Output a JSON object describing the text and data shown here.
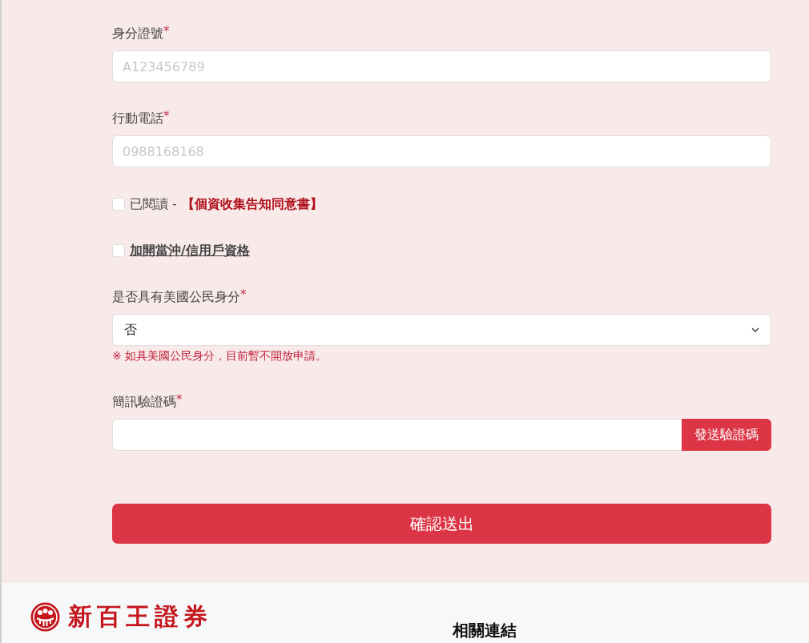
{
  "form": {
    "fields": [
      {
        "kind": "text",
        "label": "身分證號",
        "required_mark": "*",
        "placeholder": "A123456789"
      },
      {
        "kind": "text",
        "label": "行動電話",
        "required_mark": "*",
        "placeholder": "0988168168"
      },
      {
        "kind": "consent-checkbox",
        "checked": false,
        "label": "已閱讀 -",
        "link": "【個資收集告知同意書】"
      },
      {
        "kind": "link-checkbox",
        "checked": false,
        "link": "加開當沖/信用戶資格"
      },
      {
        "kind": "select",
        "label": "是否具有美國公民身分",
        "required_mark": "*",
        "value": "否",
        "note": "※ 如具美國公民身分，目前暫不開放申請。"
      },
      {
        "kind": "code",
        "label": "簡訊驗證碼",
        "required_mark": "*",
        "button": "發送驗證碼"
      }
    ],
    "submit": "確認送出"
  },
  "footer": {
    "logo_text": "新百王證券",
    "links_heading": "相關連結"
  }
}
